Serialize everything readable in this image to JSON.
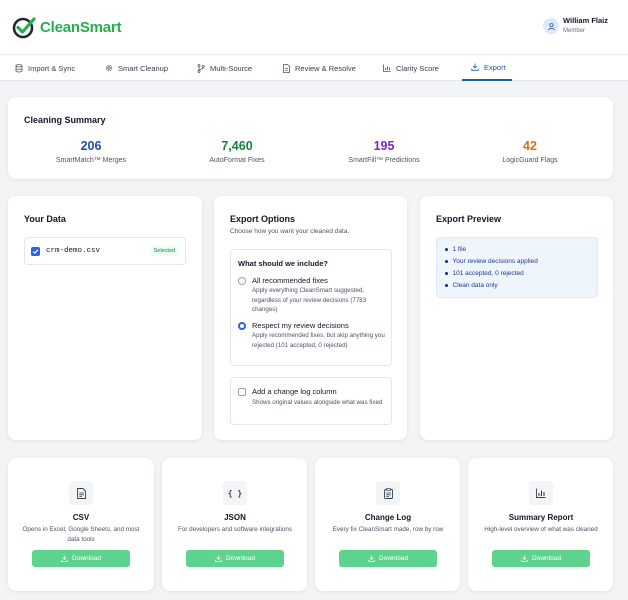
{
  "app": {
    "name": "CleanSmart"
  },
  "user": {
    "name": "William Flaiz",
    "role": "Member"
  },
  "tabs": [
    {
      "label": "Import & Sync",
      "icon": "database-icon"
    },
    {
      "label": "Smart Cleanup",
      "icon": "gear-icon"
    },
    {
      "label": "Multi-Source",
      "icon": "merge-icon"
    },
    {
      "label": "Review & Resolve",
      "icon": "document-icon"
    },
    {
      "label": "Clarity Score",
      "icon": "bar-chart-icon"
    },
    {
      "label": "Export",
      "icon": "download-icon",
      "active": true
    }
  ],
  "summary": {
    "title": "Cleaning Summary",
    "stats": [
      {
        "value": "206",
        "label": "SmartMatch™ Merges",
        "color": "#1f4fa8"
      },
      {
        "value": "7,460",
        "label": "AutoFormat Fixes",
        "color": "#15803d"
      },
      {
        "value": "195",
        "label": "SmartFill™ Predictions",
        "color": "#7e22ce"
      },
      {
        "value": "42",
        "label": "LogicGuard Flags",
        "color": "#d9700a"
      }
    ]
  },
  "your_data": {
    "title": "Your Data",
    "file": {
      "name": "crm-demo.csv",
      "badge": "Selected",
      "checked": true
    }
  },
  "export_options": {
    "title": "Export Options",
    "subtitle": "Choose how you want your cleaned data.",
    "question": "What should we include?",
    "options": [
      {
        "label": "All recommended fixes",
        "desc": "Apply everything CleanSmart suggested, regardless of your review decisions (7783 changes)",
        "selected": false
      },
      {
        "label": "Respect my review decisions",
        "desc": "Apply recommended fixes, but skip anything you rejected (101 accepted, 0 rejected)",
        "selected": true
      }
    ],
    "changelog": {
      "label": "Add a change log column",
      "desc": "Shows original values alongside what was fixed",
      "checked": false
    }
  },
  "preview": {
    "title": "Export Preview",
    "items": [
      "1 file",
      "Your review decisions applied",
      "101 accepted, 0 rejected",
      "Clean data only"
    ]
  },
  "exports": [
    {
      "title": "CSV",
      "desc": "Opens in Excel, Google Sheets, and most data tools",
      "icon": "csv-file-icon",
      "button": "Download"
    },
    {
      "title": "JSON",
      "desc": "For developers and software integrations",
      "icon": "braces-icon",
      "icon_text": "{ }",
      "button": "Download"
    },
    {
      "title": "Change Log",
      "desc": "Every fix CleanSmart made, row by row",
      "icon": "clipboard-icon",
      "button": "Download"
    },
    {
      "title": "Summary Report",
      "desc": "High-level overview of what was cleaned",
      "icon": "bar-chart-icon",
      "button": "Download"
    }
  ],
  "colors": {
    "brand_green": "#22b04b",
    "active_tab": "#1f5faa",
    "download_button": "#5ed38d",
    "preview_bg": "#eef5fd"
  }
}
